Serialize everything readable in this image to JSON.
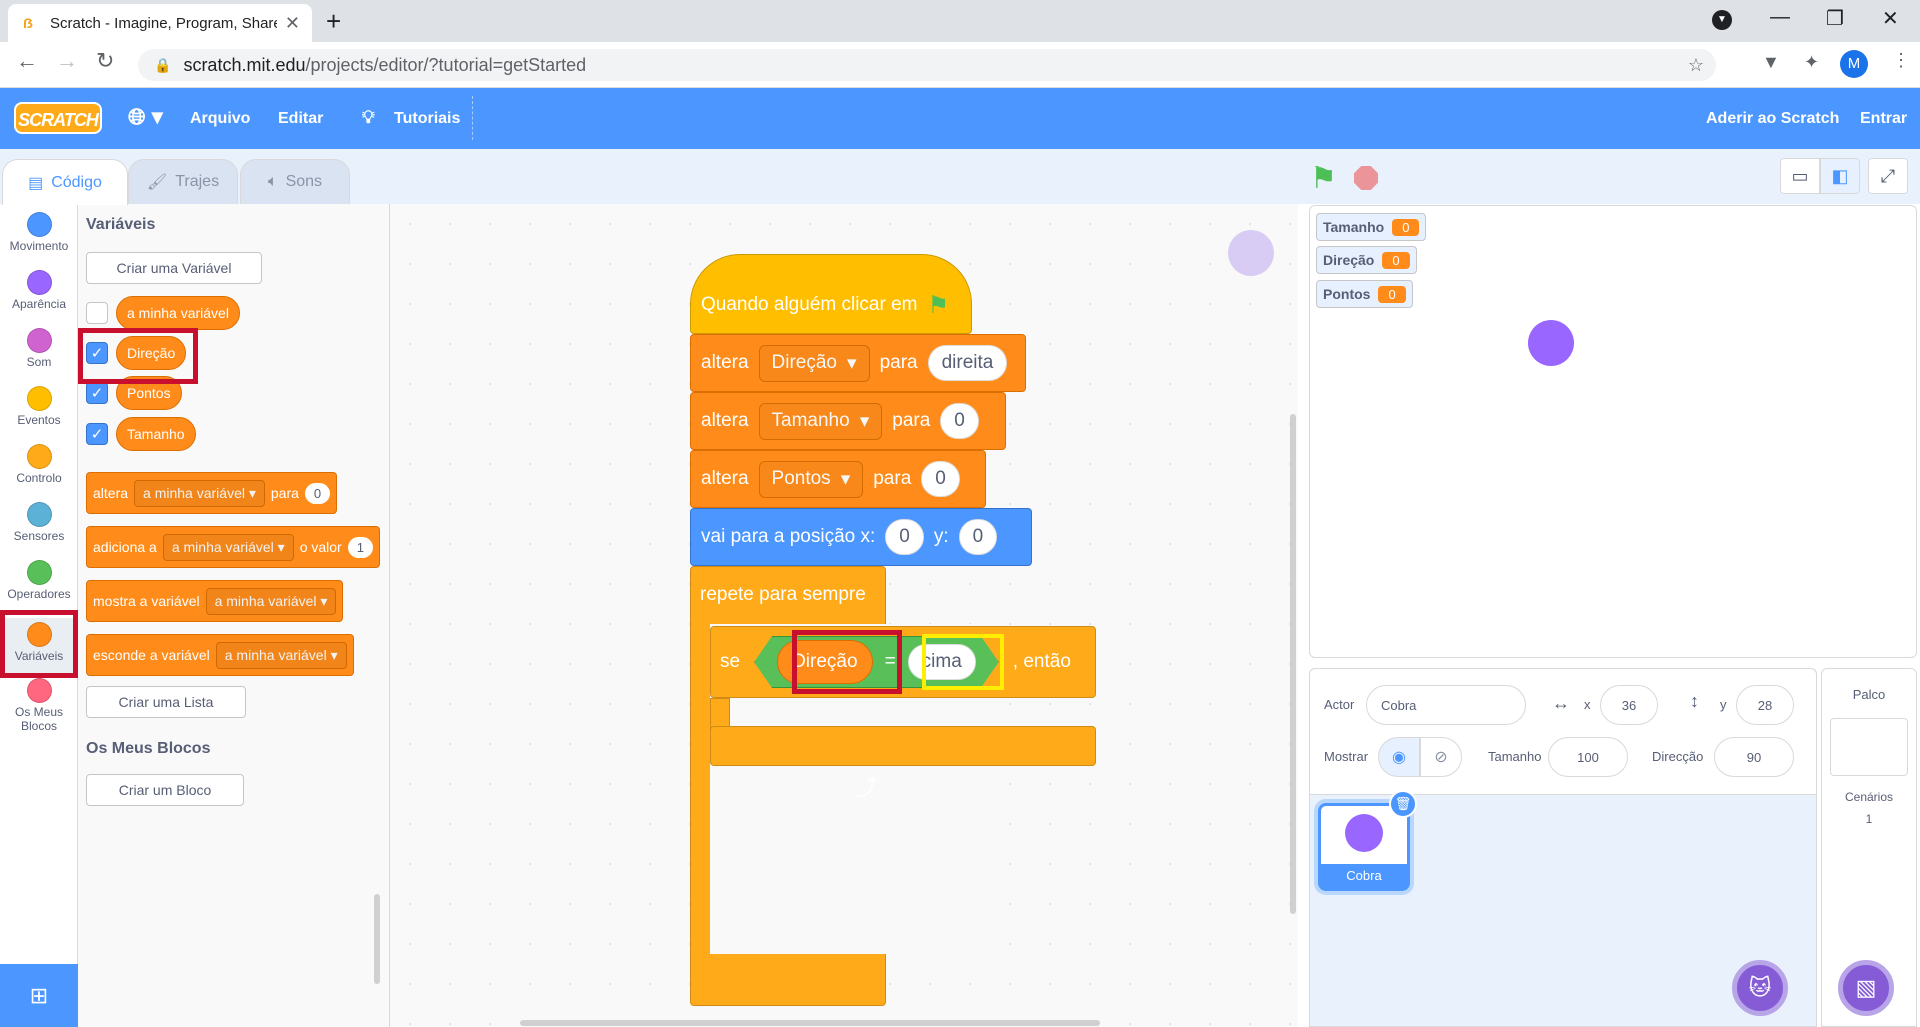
{
  "browser": {
    "tab_title": "Scratch - Imagine, Program, Share",
    "tab_icon": "scratch-favicon",
    "tab_close": "✕",
    "new_tab": "+",
    "url_host": "scratch.mit.edu",
    "url_path": "/projects/editor/?tutorial=getStarted",
    "profile_initial": "M"
  },
  "menubar": {
    "logo": "SCRATCH",
    "arquivo": "Arquivo",
    "editar": "Editar",
    "tutoriais": "Tutoriais",
    "aderir": "Aderir ao Scratch",
    "entrar": "Entrar"
  },
  "tabs": {
    "codigo": "Código",
    "trajes": "Trajes",
    "sons": "Sons"
  },
  "categories": [
    {
      "label": "Movimento",
      "color": "#4c97ff"
    },
    {
      "label": "Aparência",
      "color": "#9966ff"
    },
    {
      "label": "Som",
      "color": "#cf63cf"
    },
    {
      "label": "Eventos",
      "color": "#ffbf00"
    },
    {
      "label": "Controlo",
      "color": "#ffab19"
    },
    {
      "label": "Sensores",
      "color": "#5cb1d6"
    },
    {
      "label": "Operadores",
      "color": "#59c059"
    },
    {
      "label": "Variáveis",
      "color": "#ff8c1a"
    },
    {
      "label": "Os Meus",
      "label2": "Blocos",
      "color": "#ff6680"
    }
  ],
  "palette": {
    "heading": "Variáveis",
    "create_var": "Criar uma Variável",
    "vars": [
      "a minha variável",
      "Direção",
      "Pontos",
      "Tamanho"
    ],
    "checked": [
      false,
      true,
      true,
      true
    ],
    "set_block": {
      "a": "altera",
      "var": "a minha variável",
      "b": "para",
      "val": "0"
    },
    "change_block": {
      "a": "adiciona a",
      "var": "a minha variável",
      "b": "o valor",
      "val": "1"
    },
    "show_block": {
      "a": "mostra a variável",
      "var": "a minha variável"
    },
    "hide_block": {
      "a": "esconde a variável",
      "var": "a minha variável"
    },
    "create_list": "Criar uma Lista",
    "myblocks_heading": "Os Meus Blocos",
    "create_block": "Criar um Bloco"
  },
  "script": {
    "hat": "Quando alguém clicar em",
    "set1": {
      "a": "altera",
      "var": "Direção",
      "b": "para",
      "val": "direita"
    },
    "set2": {
      "a": "altera",
      "var": "Tamanho",
      "b": "para",
      "val": "0"
    },
    "set3": {
      "a": "altera",
      "var": "Pontos",
      "b": "para",
      "val": "0"
    },
    "goto": {
      "a": "vai para a posição x:",
      "x": "0",
      "b": "y:",
      "y": "0"
    },
    "forever": "repete para sempre",
    "if": {
      "a": "se",
      "var": "Direção",
      "op": "=",
      "val": "cima",
      "b": ", então"
    }
  },
  "zoom": {
    "in": "+",
    "out": "−",
    "reset": "="
  },
  "stage_monitors": [
    {
      "name": "Tamanho",
      "value": "0"
    },
    {
      "name": "Direção",
      "value": "0"
    },
    {
      "name": "Pontos",
      "value": "0"
    }
  ],
  "sprite_info": {
    "actor_label": "Actor",
    "actor_name": "Cobra",
    "x_label": "x",
    "x_val": "36",
    "y_label": "y",
    "y_val": "28",
    "show_label": "Mostrar",
    "size_label": "Tamanho",
    "size_val": "100",
    "dir_label": "Direcção",
    "dir_val": "90"
  },
  "sprites": [
    {
      "name": "Cobra",
      "color": "#9966ff"
    }
  ],
  "stage_pane": {
    "title": "Palco",
    "backdrops_label": "Cenários",
    "backdrops_count": "1"
  }
}
